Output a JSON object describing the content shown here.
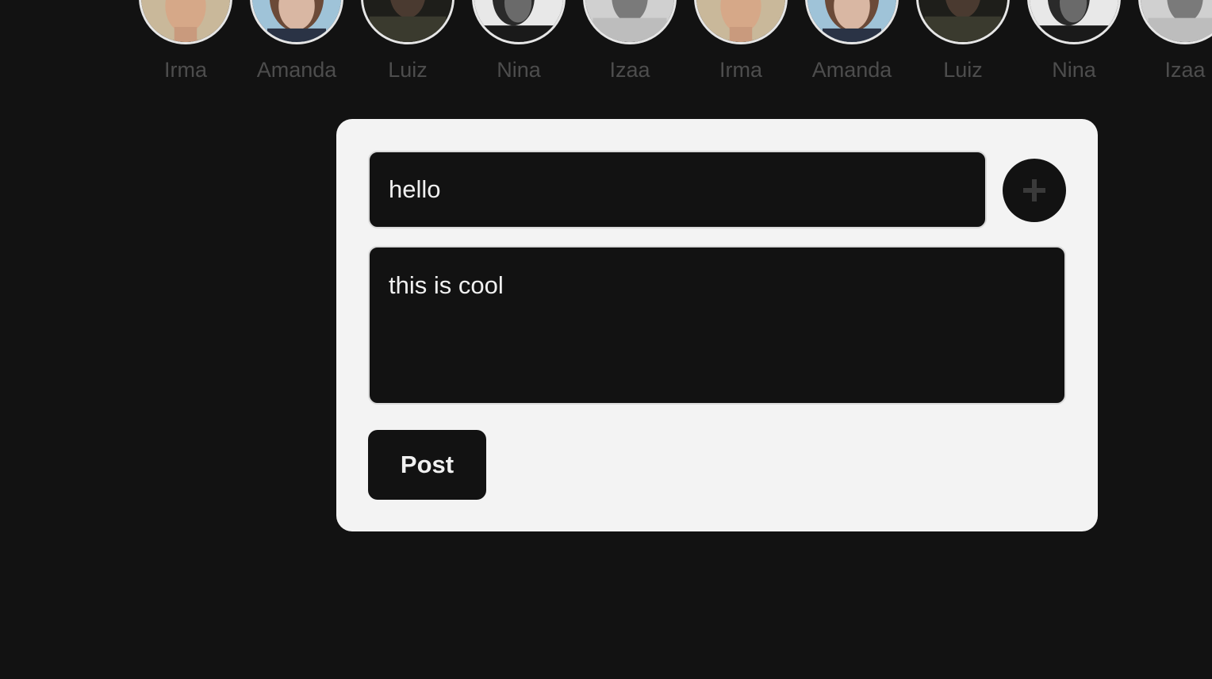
{
  "stories": [
    {
      "name": "Irma"
    },
    {
      "name": "Amanda"
    },
    {
      "name": "Luiz"
    },
    {
      "name": "Nina"
    },
    {
      "name": "Izaa"
    },
    {
      "name": "Irma"
    },
    {
      "name": "Amanda"
    },
    {
      "name": "Luiz"
    },
    {
      "name": "Nina"
    },
    {
      "name": "Izaa"
    }
  ],
  "composer": {
    "title_value": "hello",
    "body_value": "this is cool",
    "add_icon": "plus-icon",
    "post_label": "Post"
  },
  "colors": {
    "page_bg": "#121212",
    "card_bg": "#f3f3f3",
    "input_bg": "#121212",
    "story_name": "#4d4d4d",
    "plus_icon": "#3a3a3a"
  }
}
